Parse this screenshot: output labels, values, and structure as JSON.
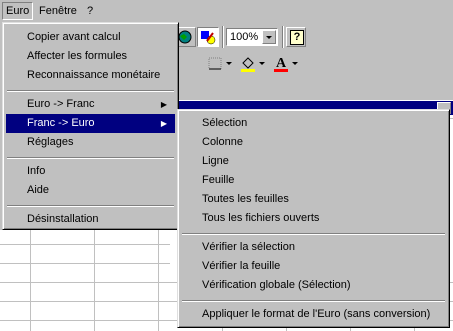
{
  "menubar": {
    "items": [
      "Euro",
      "Fenêtre",
      "?"
    ]
  },
  "toolbar": {
    "zoom_value": "100%",
    "help_icon": "?"
  },
  "euro_menu": {
    "items": [
      "Copier avant calcul",
      "Affecter les formules",
      "Reconnaissance monétaire",
      "Euro -> Franc",
      "Franc -> Euro",
      "Réglages",
      "Info",
      "Aide",
      "Désinstallation"
    ]
  },
  "franc_euro_submenu": {
    "items": [
      "Sélection",
      "Colonne",
      "Ligne",
      "Feuille",
      "Toutes les feuilles",
      "Tous les fichiers ouverts",
      "Vérifier la sélection",
      "Vérifier la feuille",
      "Vérification globale (Sélection)",
      "Appliquer le format de l'Euro (sans conversion)"
    ]
  },
  "colors": {
    "highlight": "#000080",
    "face": "#c0c0c0"
  }
}
